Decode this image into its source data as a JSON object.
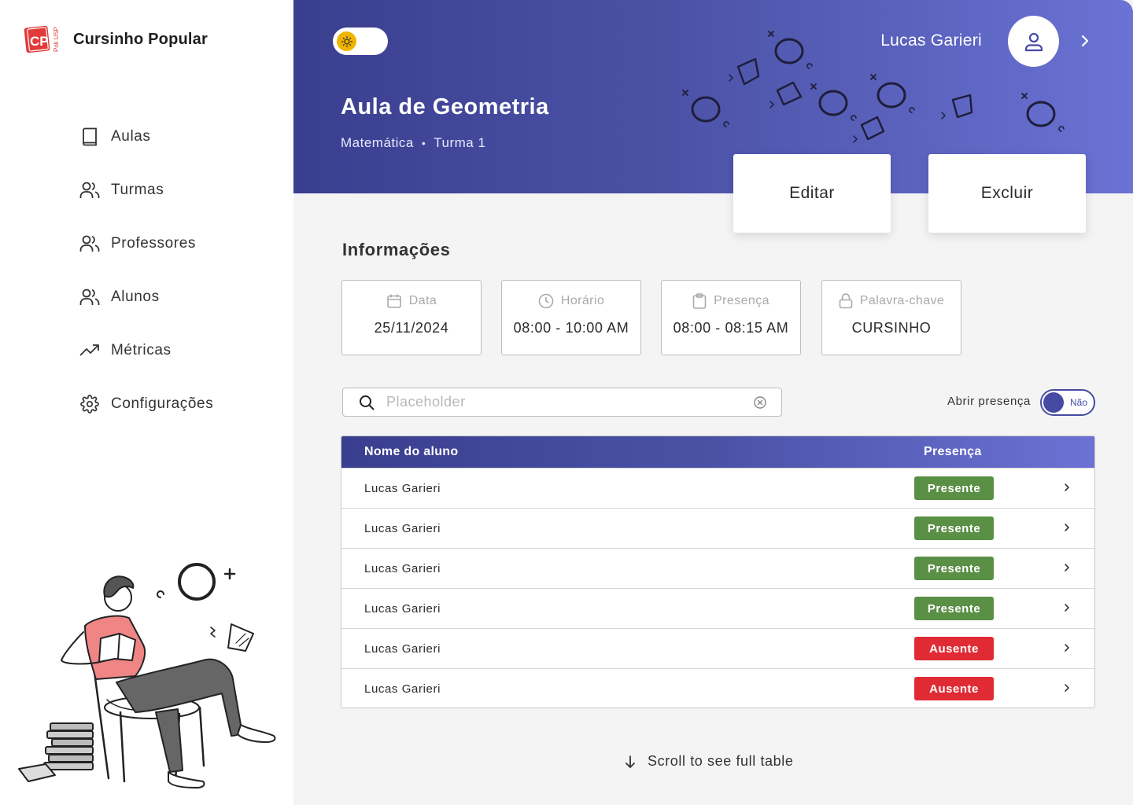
{
  "sidebar": {
    "brand_name": "Cursinho Popular",
    "logo_text": "CP",
    "logo_subtext": "Poli USP",
    "items": [
      {
        "label": "Aulas",
        "icon": "book-icon"
      },
      {
        "label": "Turmas",
        "icon": "users-icon"
      },
      {
        "label": "Professores",
        "icon": "users-icon"
      },
      {
        "label": "Alunos",
        "icon": "users-icon"
      },
      {
        "label": "Métricas",
        "icon": "trend-up-icon"
      },
      {
        "label": "Configurações",
        "icon": "gear-icon"
      }
    ]
  },
  "header": {
    "title": "Aula de Geometria",
    "subject": "Matemática",
    "separator": "•",
    "class_name": "Turma 1",
    "user_name": "Lucas Garieri",
    "edit_label": "Editar",
    "delete_label": "Excluir"
  },
  "info": {
    "section_title": "Informações",
    "cards": [
      {
        "label": "Data",
        "value": "25/11/2024",
        "icon": "calendar-icon"
      },
      {
        "label": "Horário",
        "value": "08:00 - 10:00 AM",
        "icon": "clock-icon"
      },
      {
        "label": "Presença",
        "value": "08:00 - 08:15 AM",
        "icon": "clipboard-icon"
      },
      {
        "label": "Palavra-chave",
        "value": "CURSINHO",
        "icon": "lock-icon"
      }
    ]
  },
  "search": {
    "placeholder": "Placeholder",
    "value": ""
  },
  "presence_toggle": {
    "label": "Abrir presença",
    "state": "Não"
  },
  "table": {
    "headers": {
      "name": "Nome do aluno",
      "presence": "Presença"
    },
    "rows": [
      {
        "name": "Lucas Garieri",
        "status": "Presente"
      },
      {
        "name": "Lucas Garieri",
        "status": "Presente"
      },
      {
        "name": "Lucas Garieri",
        "status": "Presente"
      },
      {
        "name": "Lucas Garieri",
        "status": "Presente"
      },
      {
        "name": "Lucas Garieri",
        "status": "Ausente"
      },
      {
        "name": "Lucas Garieri",
        "status": "Ausente"
      }
    ]
  },
  "scroll_hint": "Scroll to see full table",
  "colors": {
    "primary": "#454ba3",
    "present": "#5a8f46",
    "absent": "#e02b35",
    "logo_red": "#e23b3b"
  }
}
